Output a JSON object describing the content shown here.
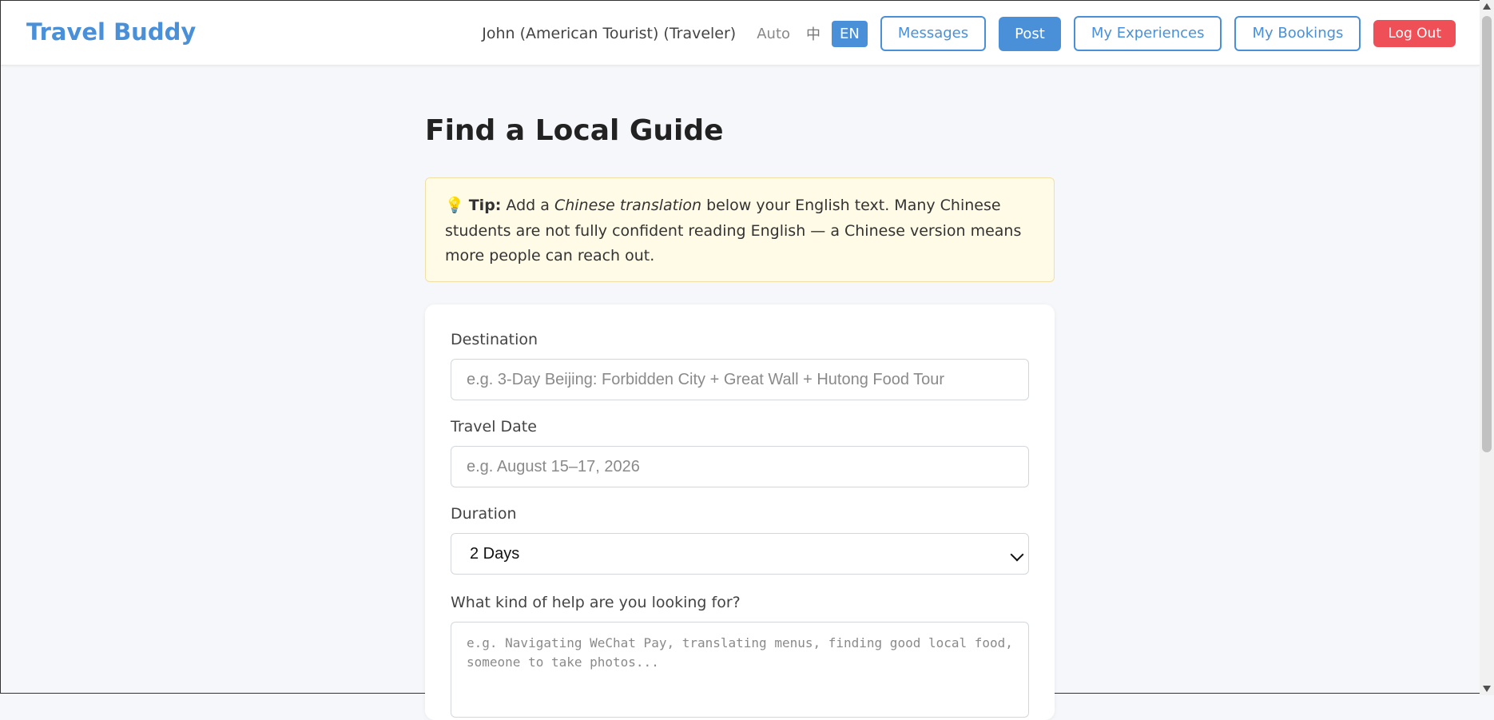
{
  "app": {
    "brand": "Travel Buddy"
  },
  "header": {
    "user": "John (American Tourist) (Traveler)",
    "lang_auto": "Auto",
    "lang_zh": "中",
    "lang_en": "EN",
    "messages": "Messages",
    "post": "Post",
    "my_experiences": "My Experiences",
    "my_bookings": "My Bookings",
    "logout": "Log Out"
  },
  "page": {
    "title": "Find a Local Guide"
  },
  "tip": {
    "icon": "lightbulb-icon",
    "emoji": "💡",
    "label": "Tip:",
    "before": " Add a ",
    "emph": "Chinese translation",
    "after": " below your English text. Many Chinese students are not fully confident reading English — a Chinese version means more people can reach out."
  },
  "form": {
    "destination_label": "Destination",
    "destination_placeholder": "e.g. 3-Day Beijing: Forbidden City + Great Wall + Hutong Food Tour",
    "date_label": "Travel Date",
    "date_placeholder": "e.g. August 15–17, 2026",
    "duration_label": "Duration",
    "duration_value": "2 Days",
    "help_label": "What kind of help are you looking for?",
    "help_placeholder": "e.g. Navigating WeChat Pay, translating menus, finding good local food, someone to take photos..."
  },
  "colors": {
    "accent": "#4a90d9",
    "danger": "#ef4f57",
    "tip_bg": "#fffbe6"
  }
}
